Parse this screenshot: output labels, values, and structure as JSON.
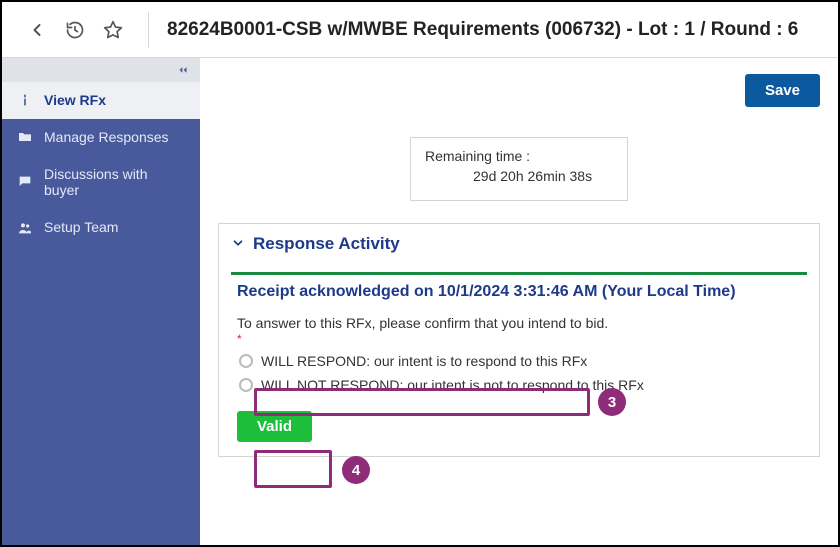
{
  "header": {
    "title": "82624B0001-CSB w/MWBE Requirements (006732) - Lot : 1 / Round : 6"
  },
  "sidebar": {
    "items": [
      {
        "label": "View RFx",
        "icon": "info"
      },
      {
        "label": "Manage Responses",
        "icon": "folder"
      },
      {
        "label": "Discussions with buyer",
        "icon": "chat"
      },
      {
        "label": "Setup Team",
        "icon": "team"
      }
    ]
  },
  "actions": {
    "save": "Save"
  },
  "time": {
    "label": "Remaining time :",
    "value": "29d 20h 26min 38s"
  },
  "panel": {
    "title": "Response Activity",
    "receipt_title": "Receipt acknowledged on 10/1/2024 3:31:46 AM (Your Local Time)",
    "instruction": "To answer to this RFx, please confirm that you intend to bid.",
    "required_mark": "*",
    "options": [
      "WILL RESPOND: our intent is to respond to this RFx",
      "WILL NOT RESPOND: our intent is not to respond to this RFx"
    ],
    "valid": "Valid"
  },
  "annotations": {
    "badge3": "3",
    "badge4": "4"
  }
}
